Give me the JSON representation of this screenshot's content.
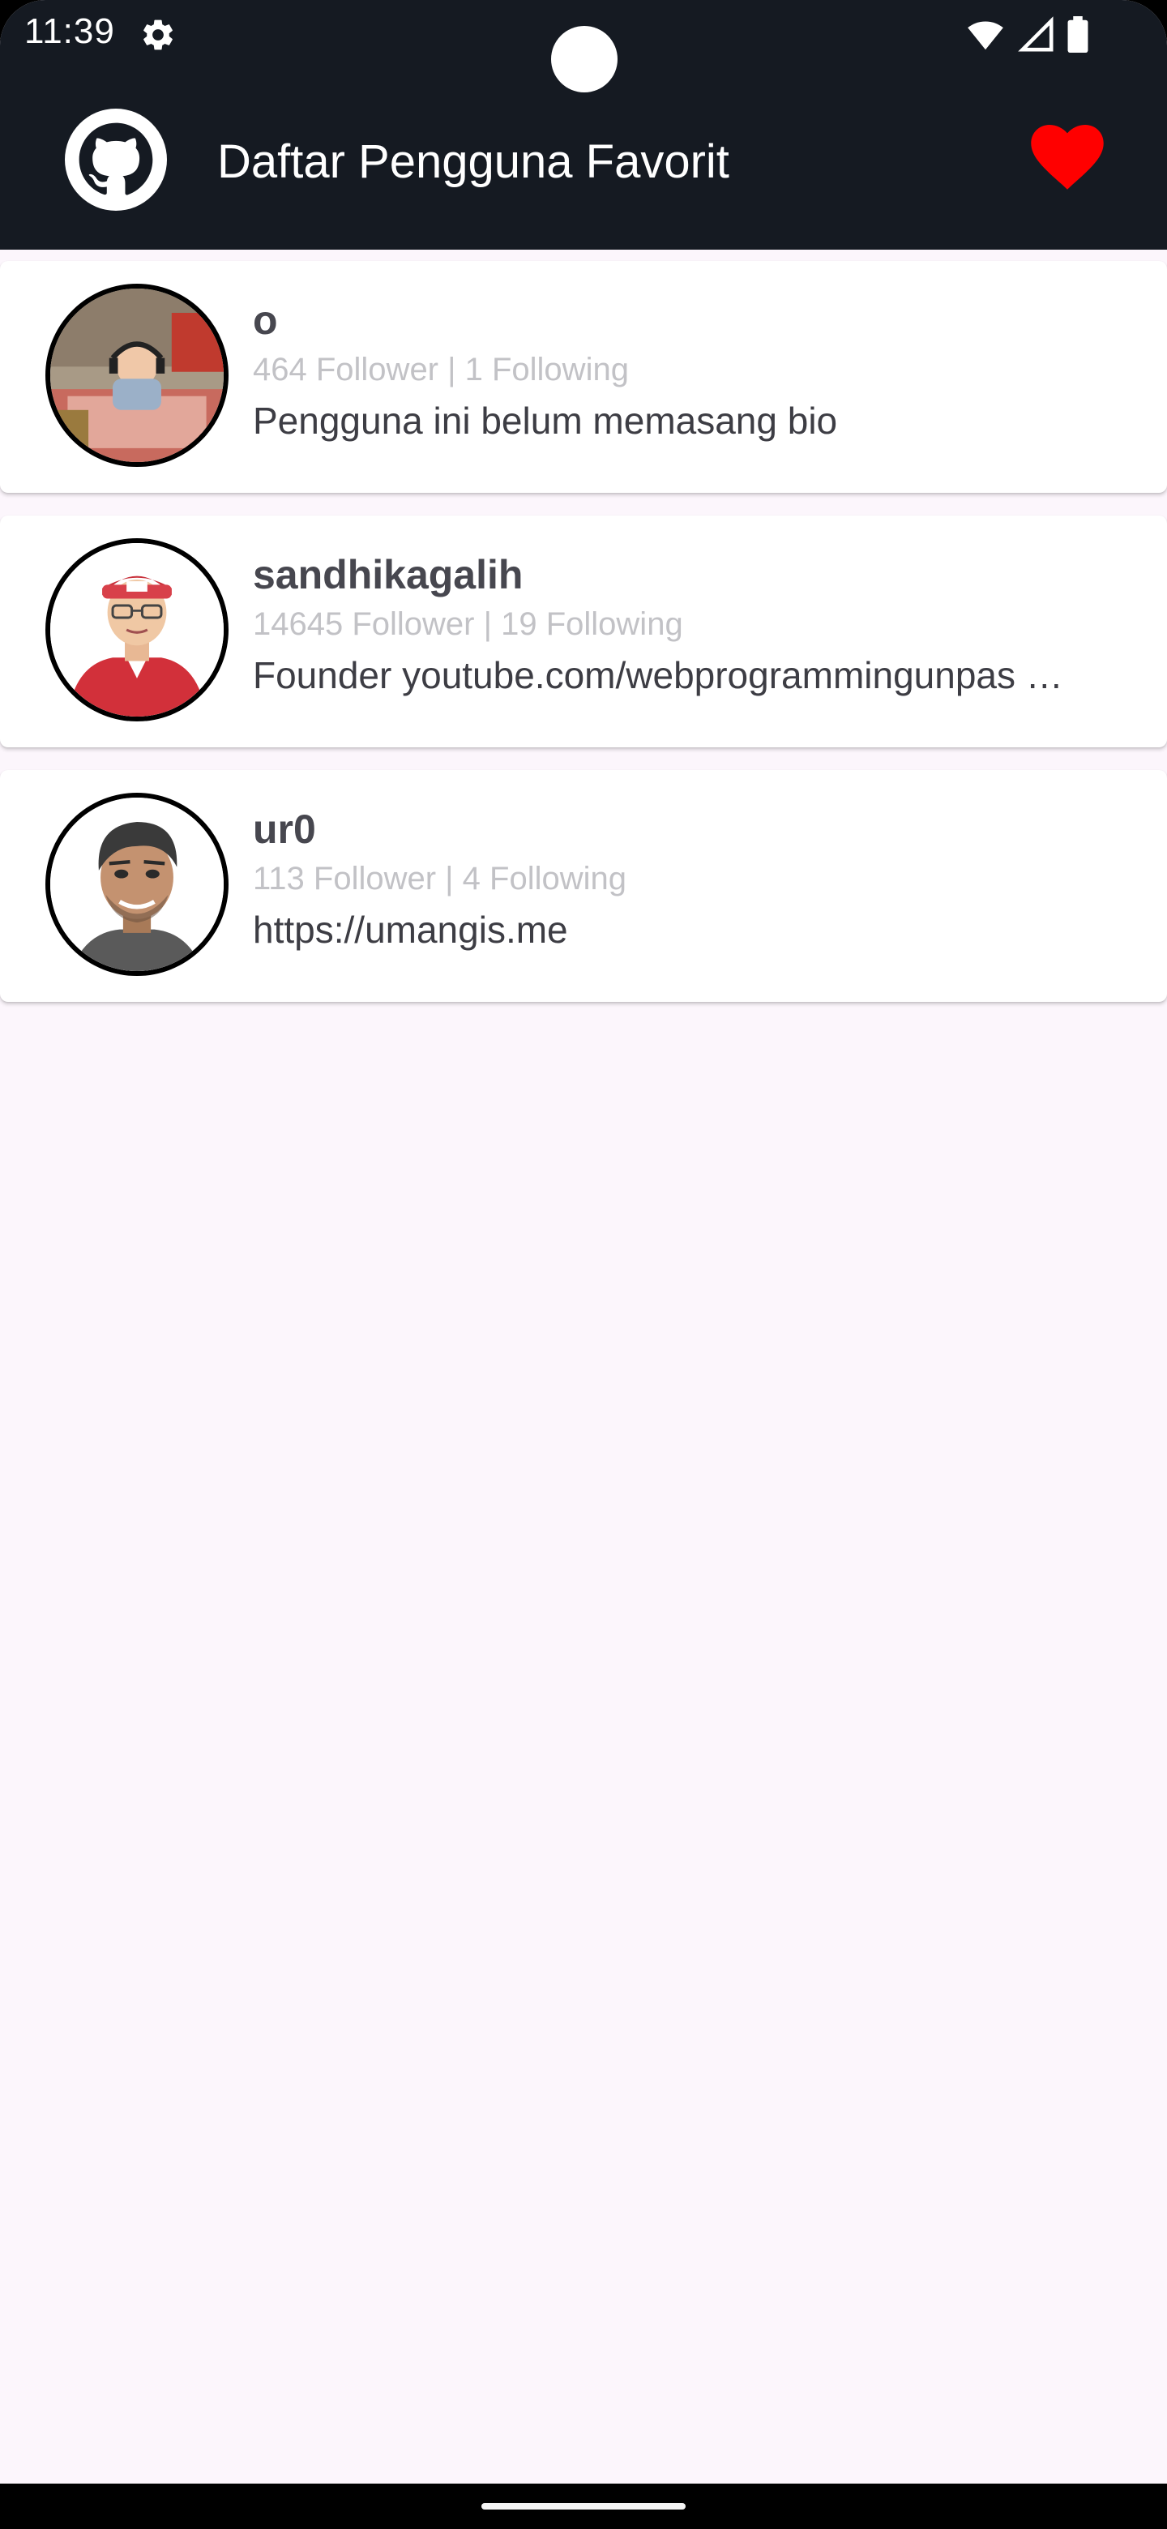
{
  "status_bar": {
    "time": "11:39",
    "icons": [
      "settings-icon",
      "wifi-icon",
      "signal-icon",
      "battery-icon"
    ]
  },
  "app_bar": {
    "title": "Daftar Pengguna Favorit",
    "logo_icon": "github-icon",
    "action_icon": "heart-icon",
    "action_color": "#ff0000"
  },
  "users": [
    {
      "name": "o",
      "stats": "464 Follower | 1 Following",
      "bio": "Pengguna ini belum memasang bio"
    },
    {
      "name": "sandhikagalih",
      "stats": "14645 Follower | 19 Following",
      "bio": "Founder youtube.com/webprogrammingunpas …"
    },
    {
      "name": "ur0",
      "stats": "113 Follower | 4 Following",
      "bio": "https://umangis.me"
    }
  ],
  "colors": {
    "app_bar_background": "#151a22",
    "page_background": "#fcf6fc",
    "card_background": "#ffffff"
  }
}
